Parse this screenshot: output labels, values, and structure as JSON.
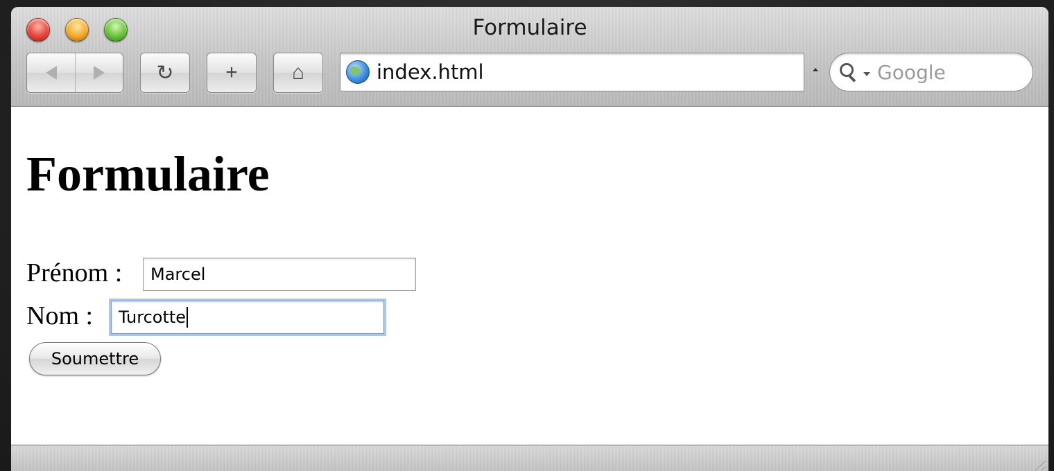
{
  "window": {
    "title": "Formulaire"
  },
  "toolbar": {
    "back_icon": "back-arrow-icon",
    "forward_icon": "forward-arrow-icon",
    "reload_icon": "reload-icon",
    "reload_glyph": "↻",
    "add_icon": "plus-icon",
    "add_glyph": "+",
    "home_icon": "home-icon",
    "home_glyph": "⌂",
    "url": "index.html",
    "search_placeholder": "Google"
  },
  "page": {
    "heading": "Formulaire",
    "fields": [
      {
        "label": "Prénom :",
        "value": "Marcel"
      },
      {
        "label": "Nom :",
        "value": "Turcotte"
      }
    ],
    "submit_label": "Soumettre"
  },
  "colors": {
    "close": "#e5463a",
    "minimize": "#f2a92a",
    "zoom": "#69c23c",
    "focus_ring": "#a9c7ea"
  }
}
